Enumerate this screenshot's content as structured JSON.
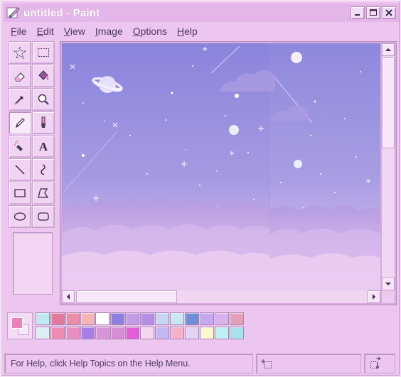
{
  "window": {
    "title": "untitled - Paint"
  },
  "title_buttons": [
    "minimize",
    "maximize",
    "close"
  ],
  "menu": [
    {
      "label": "File",
      "underline": "F",
      "rest": "ile"
    },
    {
      "label": "Edit",
      "underline": "E",
      "rest": "dit"
    },
    {
      "label": "View",
      "underline": "V",
      "rest": "iew"
    },
    {
      "label": "Image",
      "underline": "I",
      "rest": "mage"
    },
    {
      "label": "Options",
      "underline": "O",
      "rest": "ptions"
    },
    {
      "label": "Help",
      "underline": "H",
      "rest": "elp"
    }
  ],
  "tools": [
    {
      "name": "free-form-select",
      "icon": "star-select-icon"
    },
    {
      "name": "select",
      "icon": "rect-select-icon"
    },
    {
      "name": "eraser",
      "icon": "eraser-icon"
    },
    {
      "name": "fill-with-color",
      "icon": "bucket-icon"
    },
    {
      "name": "pick-color",
      "icon": "eyedropper-icon"
    },
    {
      "name": "magnifier",
      "icon": "magnifier-icon"
    },
    {
      "name": "pencil",
      "icon": "pencil-icon",
      "active": true
    },
    {
      "name": "brush",
      "icon": "brush-icon"
    },
    {
      "name": "airbrush",
      "icon": "airbrush-icon"
    },
    {
      "name": "text",
      "icon": "text-icon"
    },
    {
      "name": "line",
      "icon": "line-icon"
    },
    {
      "name": "curve",
      "icon": "curve-icon"
    },
    {
      "name": "rectangle",
      "icon": "rectangle-icon"
    },
    {
      "name": "polygon",
      "icon": "polygon-icon"
    },
    {
      "name": "ellipse",
      "icon": "ellipse-icon"
    },
    {
      "name": "rounded-rectangle",
      "icon": "rounded-rect-icon"
    }
  ],
  "palette": {
    "foreground": "#e981b8",
    "background": "#f7eaf8",
    "colors": [
      "#bfe9ee",
      "#e27a9e",
      "#e88ea6",
      "#f4b7b4",
      "#ffffff",
      "#8d7fe0",
      "#c39be8",
      "#b58ee6",
      "#c9d6f3",
      "#c8e7f0",
      "#6c8fd8",
      "#c4a9f0",
      "#d7b2ec",
      "#e3a0b6",
      "#d8f0f2",
      "#f18ab2",
      "#e98fbf",
      "#a77ee8",
      "#d995d8",
      "#d78cd6",
      "#e05fd8",
      "#f6d6ee",
      "#c4b8f2",
      "#f4b3c9",
      "#e4d4f3",
      "#fff7cf",
      "#bdf2f2",
      "#a7e3e8"
    ]
  },
  "status": {
    "help_text": "For Help, click Help Topics on the Help Menu."
  }
}
